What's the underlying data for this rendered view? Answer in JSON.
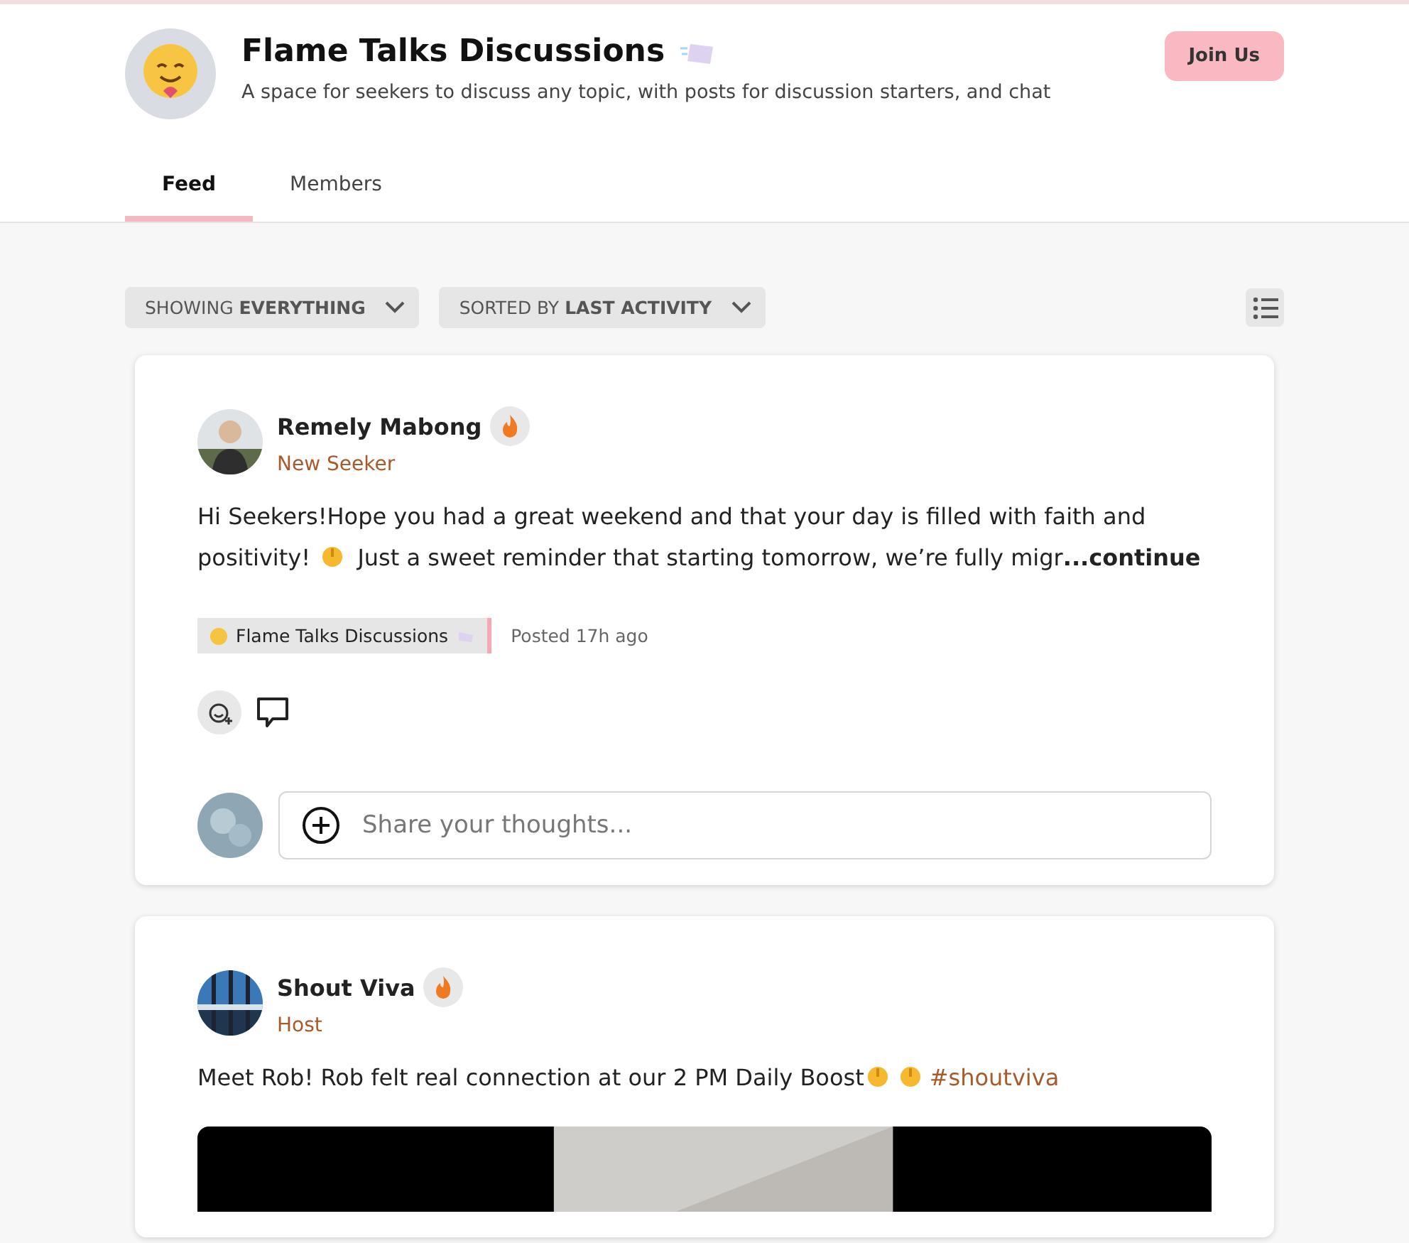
{
  "group": {
    "name": "Flame Talks Discussions",
    "description": "A space for seekers to discuss any topic, with posts for discussion starters, and chat",
    "join_button": "Join Us"
  },
  "tabs": [
    {
      "label": "Feed",
      "selected": true
    },
    {
      "label": "Members",
      "selected": false
    }
  ],
  "filters": [
    {
      "prefix": "SHOWING",
      "value": "EVERYTHING"
    },
    {
      "prefix": "SORTED BY",
      "value": "LAST ACTIVITY"
    }
  ],
  "posts": [
    {
      "author": "Remely Mabong",
      "role": "New Seeker",
      "body": [
        {
          "kind": "text",
          "text": "Hi Seekers!Hope you had a great weekend and that your day is filled with faith and positivity! "
        },
        {
          "kind": "emoji"
        },
        {
          "kind": "text",
          "text": " Just a sweet reminder that starting tomorrow, we’re fully migr"
        },
        {
          "kind": "more",
          "text": "...continue"
        }
      ],
      "tag": "Flame Talks Discussions",
      "posted": "Posted 17h ago",
      "comment_placeholder": "Share your thoughts...",
      "media": false
    },
    {
      "author": "Shout Viva",
      "role": "Host",
      "body": [
        {
          "kind": "text",
          "text": "Meet Rob! Rob felt real connection at our 2 PM Daily Boost"
        },
        {
          "kind": "emoji"
        },
        {
          "kind": "emoji"
        },
        {
          "kind": "hashtag",
          "text": "#shoutviva"
        }
      ],
      "media": true
    }
  ]
}
